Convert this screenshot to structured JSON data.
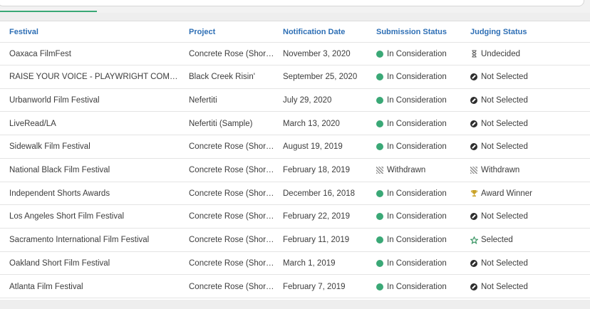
{
  "table": {
    "headers": {
      "festival": "Festival",
      "project": "Project",
      "notification_date": "Notification Date",
      "submission_status": "Submission Status",
      "judging_status": "Judging Status"
    },
    "rows": [
      {
        "festival": "Oaxaca FilmFest",
        "project": "Concrete Rose (Short ...",
        "date": "November 3, 2020",
        "submission": "In Consideration",
        "submission_icon": "green-dot-icon",
        "judging": "Undecided",
        "judging_icon": "hourglass-icon"
      },
      {
        "festival": "RAISE YOUR VOICE - PLAYWRIGHT COMPETITI...",
        "project": "Black Creek Risin'",
        "date": "September 25, 2020",
        "submission": "In Consideration",
        "submission_icon": "green-dot-icon",
        "judging": "Not Selected",
        "judging_icon": "not-selected-icon"
      },
      {
        "festival": "Urbanworld Film Festival",
        "project": "Nefertiti",
        "date": "July 29, 2020",
        "submission": "In Consideration",
        "submission_icon": "green-dot-icon",
        "judging": "Not Selected",
        "judging_icon": "not-selected-icon"
      },
      {
        "festival": "LiveRead/LA",
        "project": "Nefertiti (Sample)",
        "date": "March 13, 2020",
        "submission": "In Consideration",
        "submission_icon": "green-dot-icon",
        "judging": "Not Selected",
        "judging_icon": "not-selected-icon"
      },
      {
        "festival": "Sidewalk Film Festival",
        "project": "Concrete Rose (Short ...",
        "date": "August 19, 2019",
        "submission": "In Consideration",
        "submission_icon": "green-dot-icon",
        "judging": "Not Selected",
        "judging_icon": "not-selected-icon"
      },
      {
        "festival": "National Black Film Festival",
        "project": "Concrete Rose (Short ...",
        "date": "February 18, 2019",
        "submission": "Withdrawn",
        "submission_icon": "withdrawn-icon",
        "judging": "Withdrawn",
        "judging_icon": "withdrawn-icon"
      },
      {
        "festival": "Independent Shorts Awards",
        "project": "Concrete Rose (Short ...",
        "date": "December 16, 2018",
        "submission": "In Consideration",
        "submission_icon": "green-dot-icon",
        "judging": "Award Winner",
        "judging_icon": "trophy-icon"
      },
      {
        "festival": "Los Angeles Short Film Festival",
        "project": "Concrete Rose (Short ...",
        "date": "February 22, 2019",
        "submission": "In Consideration",
        "submission_icon": "green-dot-icon",
        "judging": "Not Selected",
        "judging_icon": "not-selected-icon"
      },
      {
        "festival": "Sacramento International Film Festival",
        "project": "Concrete Rose (Short ...",
        "date": "February 11, 2019",
        "submission": "In Consideration",
        "submission_icon": "green-dot-icon",
        "judging": "Selected",
        "judging_icon": "star-icon"
      },
      {
        "festival": "Oakland Short Film Festival",
        "project": "Concrete Rose (Short ...",
        "date": "March 1, 2019",
        "submission": "In Consideration",
        "submission_icon": "green-dot-icon",
        "judging": "Not Selected",
        "judging_icon": "not-selected-icon"
      },
      {
        "festival": "Atlanta Film Festival",
        "project": "Concrete Rose (Short ...",
        "date": "February 7, 2019",
        "submission": "In Consideration",
        "submission_icon": "green-dot-icon",
        "judging": "Not Selected",
        "judging_icon": "not-selected-icon"
      }
    ]
  },
  "colors": {
    "accent_green": "#3aa876",
    "header_blue": "#2e6fb5",
    "trophy_gold": "#c9a227",
    "star_green": "#2f8f5b"
  }
}
